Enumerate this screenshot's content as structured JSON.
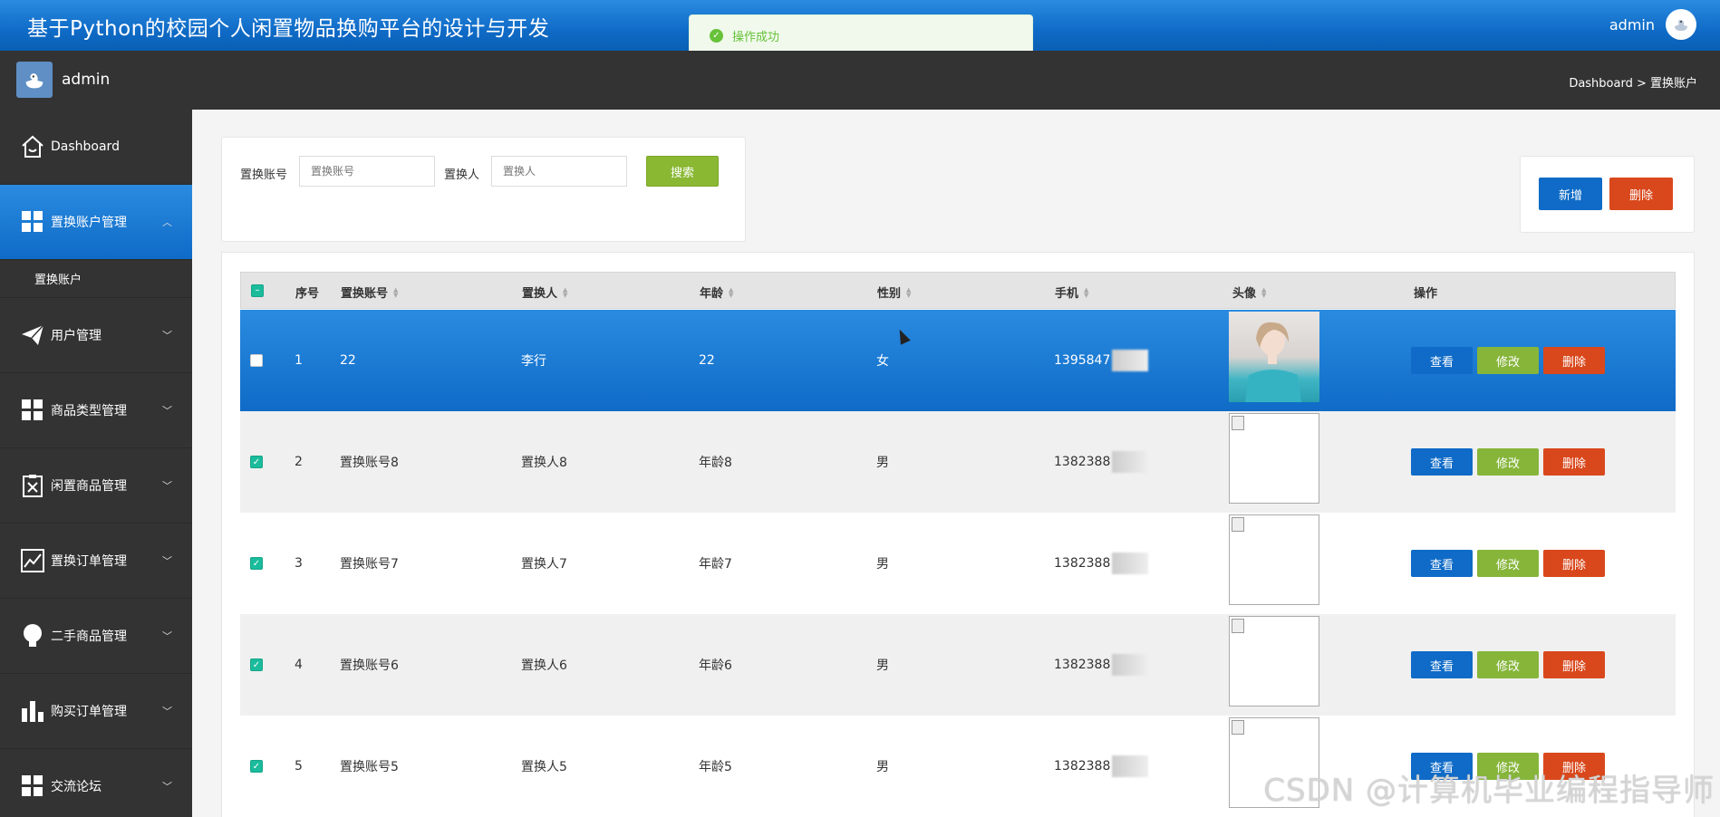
{
  "app": {
    "title": "基于Python的校园个人闲置物品换购平台的设计与开发",
    "top_user": "admin"
  },
  "toast": {
    "message": "操作成功"
  },
  "subbar": {
    "user": "admin",
    "breadcrumb": "Dashboard > 置换账户"
  },
  "sidebar": {
    "items": [
      {
        "label": "Dashboard",
        "icon": "home-icon"
      },
      {
        "label": "置换账户管理",
        "icon": "grid-icon",
        "active": true
      },
      {
        "label": "用户管理",
        "icon": "paper-plane-icon"
      },
      {
        "label": "商品类型管理",
        "icon": "grid-icon"
      },
      {
        "label": "闲置商品管理",
        "icon": "clipboard-x-icon"
      },
      {
        "label": "置换订单管理",
        "icon": "line-chart-icon"
      },
      {
        "label": "二手商品管理",
        "icon": "lightbulb-icon"
      },
      {
        "label": "购买订单管理",
        "icon": "bar-chart-icon"
      },
      {
        "label": "交流论坛",
        "icon": "grid-icon"
      }
    ],
    "subitem": "置换账户"
  },
  "search": {
    "account_label": "置换账号",
    "account_placeholder": "置换账号",
    "person_label": "置换人",
    "person_placeholder": "置换人",
    "button": "搜索"
  },
  "actions": {
    "add": "新增",
    "delete": "删除"
  },
  "table": {
    "headers": [
      "序号",
      "置换账号",
      "置换人",
      "年龄",
      "性别",
      "手机",
      "头像",
      "操作"
    ],
    "rows": [
      {
        "no": "1",
        "account": "22",
        "person": "李行",
        "age": "22",
        "gender": "女",
        "phone": "1395847",
        "selected": true,
        "checked": false
      },
      {
        "no": "2",
        "account": "置换账号8",
        "person": "置换人8",
        "age": "年龄8",
        "gender": "男",
        "phone": "1382388",
        "selected": false,
        "checked": true
      },
      {
        "no": "3",
        "account": "置换账号7",
        "person": "置换人7",
        "age": "年龄7",
        "gender": "男",
        "phone": "1382388",
        "selected": false,
        "checked": true
      },
      {
        "no": "4",
        "account": "置换账号6",
        "person": "置换人6",
        "age": "年龄6",
        "gender": "男",
        "phone": "1382388",
        "selected": false,
        "checked": true
      },
      {
        "no": "5",
        "account": "置换账号5",
        "person": "置换人5",
        "age": "年龄5",
        "gender": "男",
        "phone": "1382388",
        "selected": false,
        "checked": true
      }
    ],
    "row_buttons": {
      "view": "查看",
      "edit": "修改",
      "delete": "删除"
    }
  },
  "watermark": "CSDN @计算机毕业编程指导师",
  "colors": {
    "primary": "#0f6bc7",
    "danger": "#d9481c",
    "success": "#86b53a",
    "sidebar": "#333333"
  }
}
